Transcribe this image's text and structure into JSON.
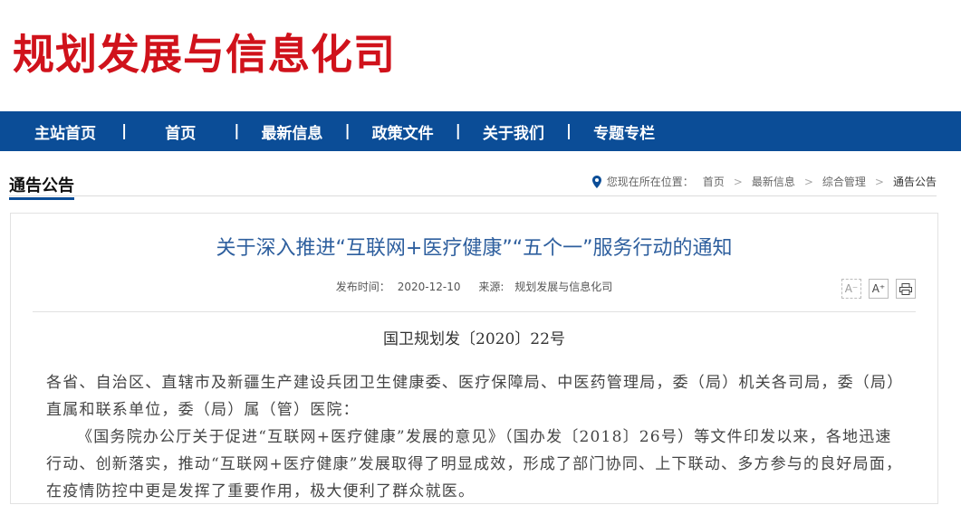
{
  "site": {
    "title": "规划发展与信息化司"
  },
  "nav": {
    "items": [
      "主站首页",
      "首页",
      "最新信息",
      "政策文件",
      "关于我们",
      "专题专栏"
    ],
    "separator": "|"
  },
  "section": {
    "title": "通告公告"
  },
  "breadcrumb": {
    "prefix": "您现在所在位置：",
    "items": [
      "首页",
      "最新信息",
      "综合管理",
      "通告公告"
    ],
    "sep": ">"
  },
  "article": {
    "title": "关于深入推进“互联网+医疗健康”“五个一”服务行动的通知",
    "publish_label": "发布时间：",
    "publish_date": "2020-12-10",
    "source_label": "来源:",
    "source": "规划发展与信息化司",
    "tools": {
      "font_smaller": "A⁻",
      "font_larger": "A⁺",
      "print": "⎙"
    },
    "doc_number": "国卫规划发〔2020〕22号",
    "paragraphs": [
      "各省、自治区、直辖市及新疆生产建设兵团卫生健康委、医疗保障局、中医药管理局，委（局）机关各司局，委（局）直属和联系单位，委（局）属（管）医院：",
      "《国务院办公厅关于促进“互联网+医疗健康”发展的意见》（国办发〔2018〕26号）等文件印发以来，各地迅速行动、创新落实，推动“互联网+医疗健康”发展取得了明显成效，形成了部门协同、上下联动、多方参与的良好局面，在疫情防控中更是发挥了重要作用，极大便利了群众就医。"
    ]
  },
  "colors": {
    "brand_red": "#d0121b",
    "nav_blue": "#0b4d97",
    "title_blue": "#2e5f9e"
  }
}
